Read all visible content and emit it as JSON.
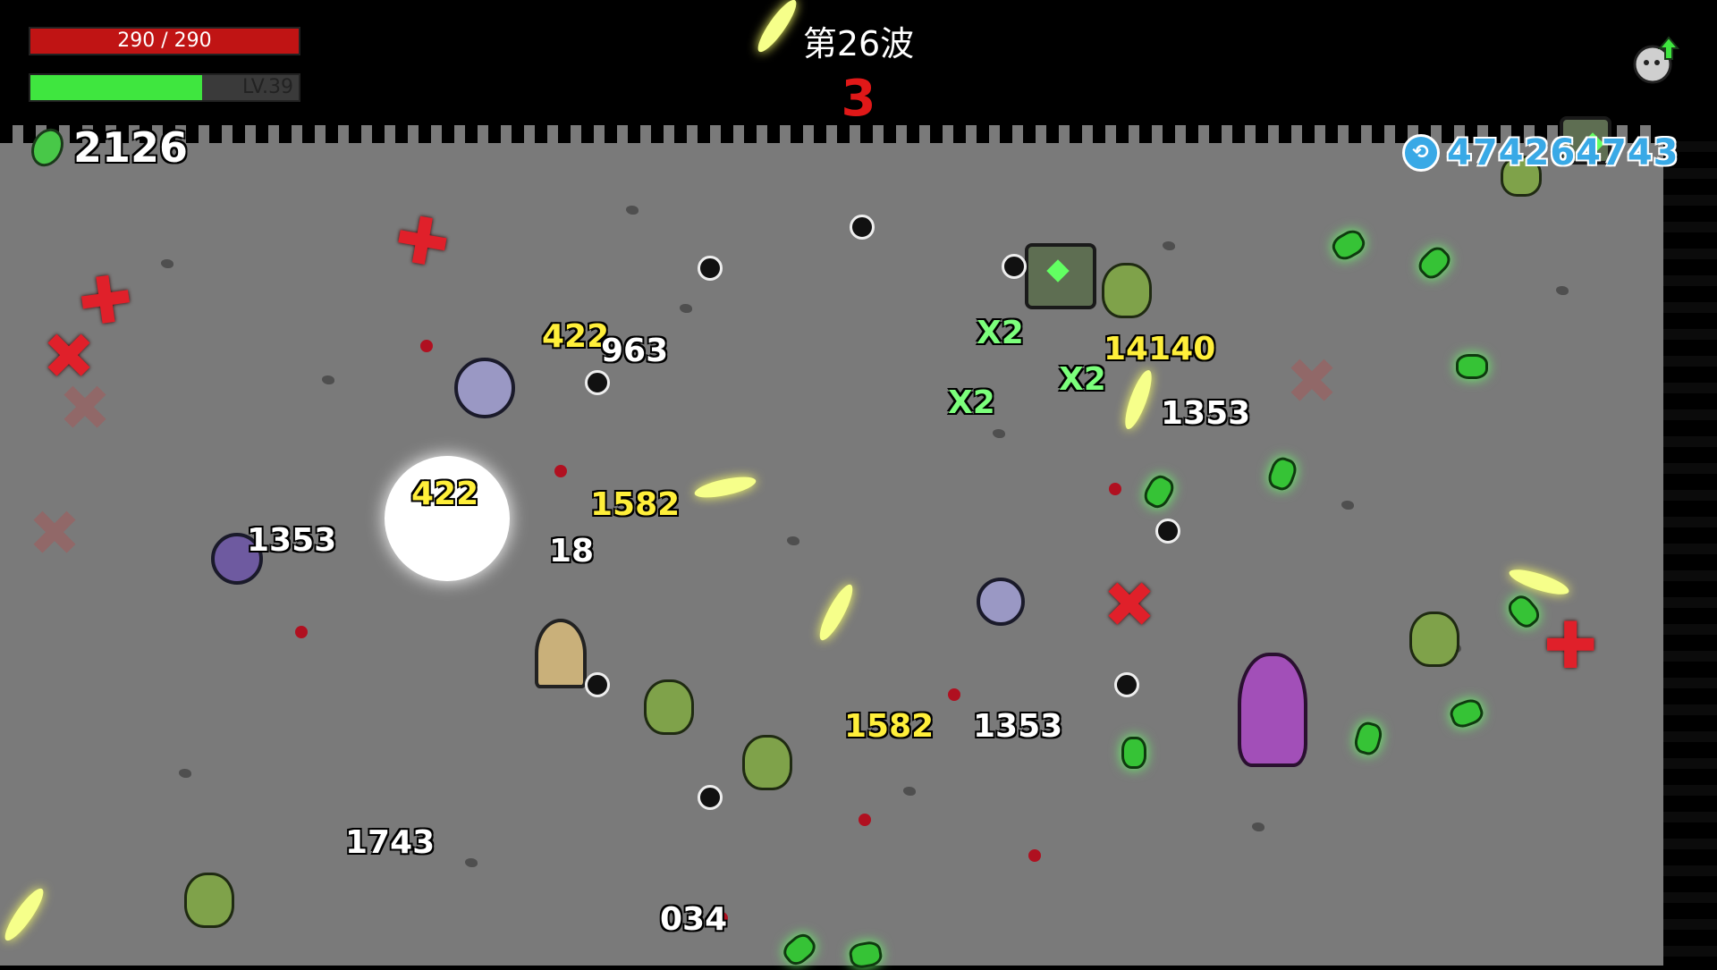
{
  "hud": {
    "hp_text": "290 / 290",
    "hp_fraction": 1.0,
    "level_text": "LV.39",
    "xp_fraction": 0.64,
    "materials": "2126",
    "bank": "474264743"
  },
  "wave": {
    "title": "第26波",
    "timer": "3"
  },
  "damage_numbers": {
    "d1": "422",
    "d2": "963",
    "d3": "422",
    "d4": "1582",
    "d5": "1353",
    "d6": "18",
    "d7": "1582",
    "d8": "1353",
    "d9": "1743",
    "d10": "034",
    "d11": "14140",
    "d12": "1353",
    "x1": "X2",
    "x2": "X2",
    "x3": "X2"
  },
  "colors": {
    "hp": "#c01414",
    "xp": "#3fe63f",
    "timer": "#e01818",
    "bank": "#39a9e6",
    "crit": "#ffef3a"
  },
  "icons": {
    "materials": "material-icon",
    "bank": "bank-icon",
    "levelup": "levelup-icon",
    "cross": "red-cross-icon"
  }
}
